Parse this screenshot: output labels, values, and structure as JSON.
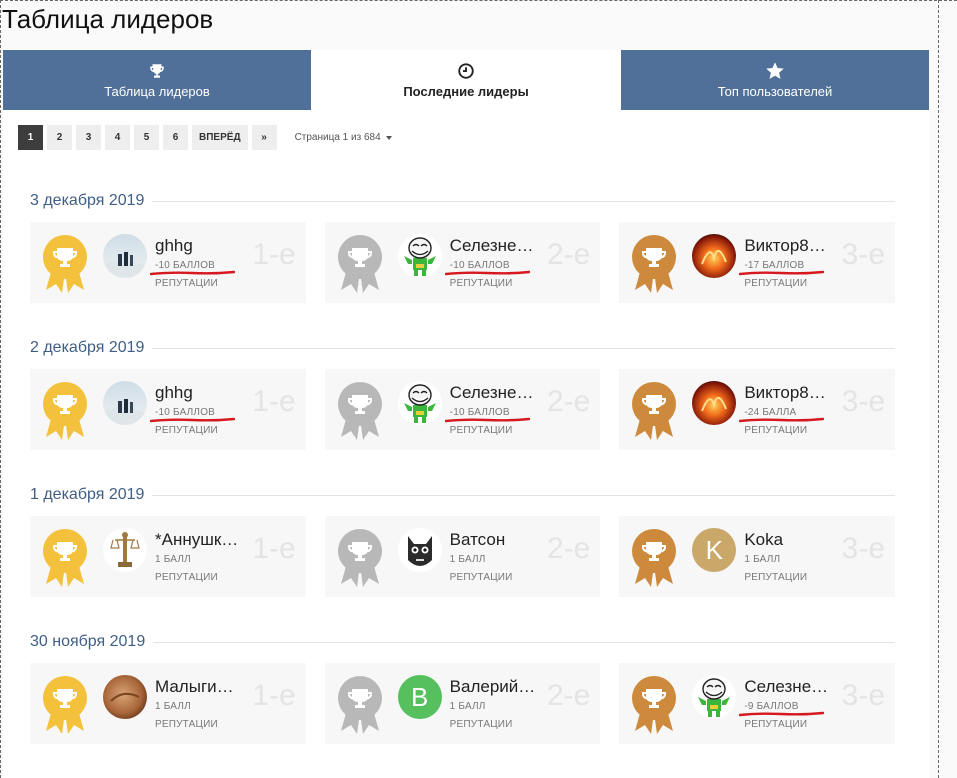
{
  "page_title": "Таблица лидеров",
  "tabs": [
    {
      "label": "Таблица лидеров",
      "icon": "trophy-icon",
      "active": false
    },
    {
      "label": "Последние лидеры",
      "icon": "clock-icon",
      "active": true
    },
    {
      "label": "Топ пользователей",
      "icon": "star-icon",
      "active": false
    }
  ],
  "pager": {
    "pages": [
      "1",
      "2",
      "3",
      "4",
      "5",
      "6"
    ],
    "next": "ВПЕРЁД",
    "last": "»",
    "info": "Страница 1 из 684"
  },
  "colors": {
    "tab_bg": "#50709a",
    "gold": "#f3c13c",
    "silver": "#b8b8b8",
    "bronze": "#cd8a3c",
    "date": "#3f5e86",
    "annotation": "#d6181f"
  },
  "days": [
    {
      "date": "3 декабря 2019",
      "leaders": [
        {
          "name": "ghhg",
          "score": "-10 БАЛЛОВ",
          "rep": "РЕПУТАЦИИ",
          "place": "1-е",
          "medal": "gold",
          "avatar": "photo-people",
          "underlined": true
        },
        {
          "name": "Селезне…",
          "score": "-10 БАЛЛОВ",
          "rep": "РЕПУТАЦИИ",
          "place": "2-е",
          "medal": "silver",
          "avatar": "troll-face",
          "underlined": true
        },
        {
          "name": "Виктор8…",
          "score": "-17 БАЛЛОВ",
          "rep": "РЕПУТАЦИИ",
          "place": "3-е",
          "medal": "bronze",
          "avatar": "fire-photo",
          "underlined": true
        }
      ]
    },
    {
      "date": "2 декабря 2019",
      "leaders": [
        {
          "name": "ghhg",
          "score": "-10 БАЛЛОВ",
          "rep": "РЕПУТАЦИИ",
          "place": "1-е",
          "medal": "gold",
          "avatar": "photo-people",
          "underlined": true
        },
        {
          "name": "Селезне…",
          "score": "-10 БАЛЛОВ",
          "rep": "РЕПУТАЦИИ",
          "place": "2-е",
          "medal": "silver",
          "avatar": "troll-face",
          "underlined": true
        },
        {
          "name": "Виктор8…",
          "score": "-24 БАЛЛА",
          "rep": "РЕПУТАЦИИ",
          "place": "3-е",
          "medal": "bronze",
          "avatar": "fire-photo",
          "underlined": true
        }
      ]
    },
    {
      "date": "1 декабря 2019",
      "leaders": [
        {
          "name": "*Аннушк…",
          "score": "1 БАЛЛ",
          "rep": "РЕПУТАЦИИ",
          "place": "1-е",
          "medal": "gold",
          "avatar": "statue",
          "underlined": false
        },
        {
          "name": "Ватсон",
          "score": "1 БАЛЛ",
          "rep": "РЕПУТАЦИИ",
          "place": "2-е",
          "medal": "silver",
          "avatar": "wolf",
          "underlined": false
        },
        {
          "name": "Koka",
          "score": "1 БАЛЛ",
          "rep": "РЕПУТАЦИИ",
          "place": "3-е",
          "medal": "bronze",
          "avatar": "letter",
          "letter": "K",
          "letter_bg": "#c9a86a",
          "underlined": false
        }
      ]
    },
    {
      "date": "30 ноября 2019",
      "leaders": [
        {
          "name": "Малыги…",
          "score": "1 БАЛЛ",
          "rep": "РЕПУТАЦИИ",
          "place": "1-е",
          "medal": "gold",
          "avatar": "brown-photo",
          "underlined": false
        },
        {
          "name": "Валерий…",
          "score": "1 БАЛЛ",
          "rep": "РЕПУТАЦИИ",
          "place": "2-е",
          "medal": "silver",
          "avatar": "letter",
          "letter": "B",
          "letter_bg": "#55c05d",
          "underlined": false
        },
        {
          "name": "Селезне…",
          "score": "-9 БАЛЛОВ",
          "rep": "РЕПУТАЦИИ",
          "place": "3-е",
          "medal": "bronze",
          "avatar": "troll-face",
          "underlined": true
        }
      ]
    }
  ]
}
